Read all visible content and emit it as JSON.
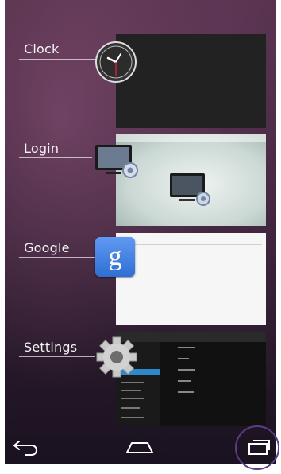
{
  "recents": [
    {
      "label": "Clock"
    },
    {
      "label": "Login"
    },
    {
      "label": "Google"
    },
    {
      "label": "Settings"
    }
  ],
  "icons": {
    "clock": "clock-icon",
    "login": "monitor-gear-icon",
    "google": "google-search-icon",
    "settings": "gear-icon",
    "back": "back-arrow-icon",
    "home": "home-icon",
    "recents": "recent-apps-icon"
  },
  "colors": {
    "label_text": "#f4f4f4",
    "highlight_ring": "#5b3d86",
    "google_blue": "#3f7fe0"
  }
}
